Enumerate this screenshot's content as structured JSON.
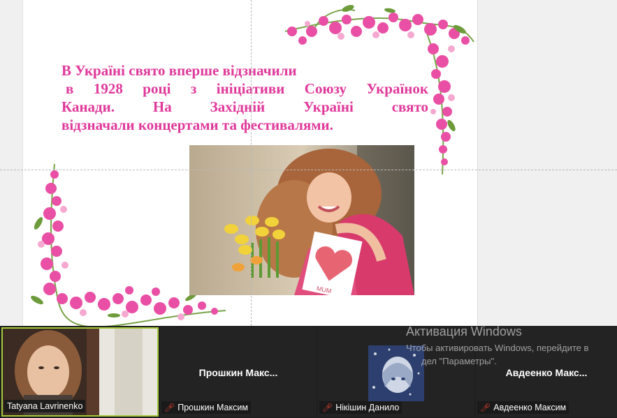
{
  "slide": {
    "lines": [
      "В Україні свято вперше відзначили",
      "в 1928 році з ініціативи Союзу Українок",
      "Канади. На Західній Україні свято",
      "відзначали концертами та фестивалями."
    ],
    "photo_text": "MUM",
    "text_color": "#e0399a"
  },
  "participants": [
    {
      "name": "Tatyana Lavrinenko",
      "title": "",
      "muted": false,
      "has_video": true
    },
    {
      "name": "Прошкин Максим",
      "title": "Прошкин  Макс...",
      "muted": true,
      "has_video": false
    },
    {
      "name": "Нікішин Данило",
      "title": "",
      "muted": true,
      "has_video": false,
      "avatar": "anime-avatar"
    },
    {
      "name": "Авдеенко Максим",
      "title": "Авдеенко  Макс...",
      "muted": true,
      "has_video": false
    }
  ],
  "activation": {
    "title": "Активация Windows",
    "line1": "Чтобы активировать Windows, перейдите в",
    "line2": "дел \"Параметры\"."
  },
  "colors": {
    "active_speaker_border": "#a5c93a",
    "mic_muted": "#e0402f",
    "strip_bg": "#1e1e1e"
  },
  "icons": [
    "mic-muted-icon"
  ]
}
